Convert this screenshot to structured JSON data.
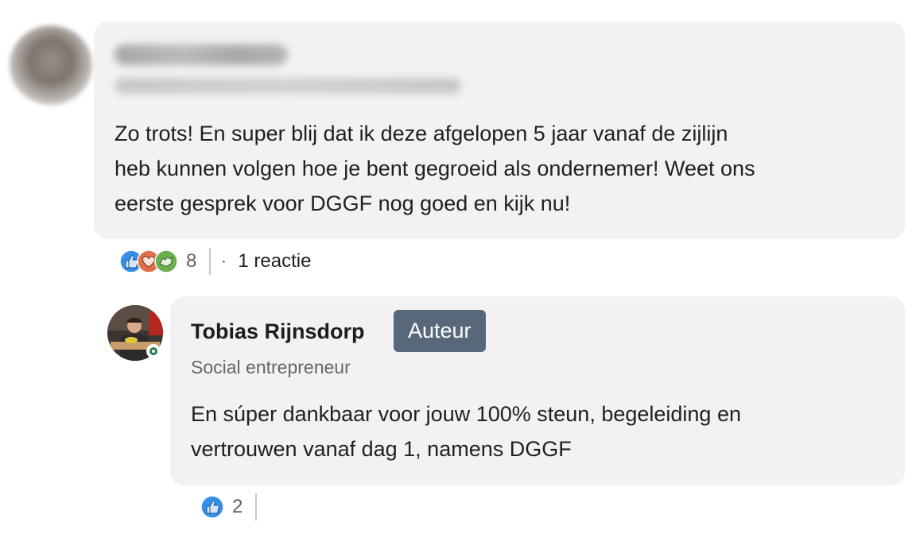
{
  "comment_1": {
    "text_lines": [
      "Zo trots! En super blij dat ik deze afgelopen 5 jaar vanaf de zijlijn",
      "heb kunnen volgen hoe je bent gegroeid als ondernemer! Weet ons",
      "eerste gesprek voor DGGF nog goed en kijk nu!"
    ],
    "reaction_icons": [
      "like-icon",
      "love-icon",
      "support-icon"
    ],
    "reaction_count": "8",
    "separator": "·",
    "replies_label": "1 reactie"
  },
  "reply_1": {
    "author_name": "Tobias Rijnsdorp",
    "badge": "Auteur",
    "headline": "Social entrepreneur",
    "text_lines": [
      "En súper dankbaar voor jouw 100% steun, begeleiding en",
      "vertrouwen vanaf dag 1, namens DGGF"
    ],
    "reaction_icons": [
      "like-icon"
    ],
    "reaction_count": "2"
  },
  "colors": {
    "bubble_bg": "#f2f2f2",
    "badge_bg": "#56687a",
    "like_blue": "#378fe9",
    "love_red": "#df704d",
    "support_green": "#6dae4f",
    "online_green": "#2e7d4f"
  }
}
